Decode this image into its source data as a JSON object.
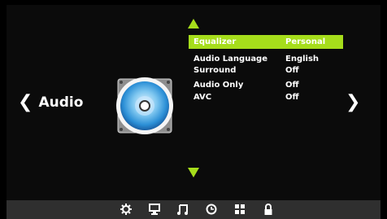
{
  "section": {
    "title": "Audio",
    "prev_icon": "chevron-left-icon",
    "next_icon": "chevron-right-icon"
  },
  "menu": {
    "items": [
      {
        "label": "Equalizer",
        "value": "Personal",
        "selected": true
      },
      {
        "label": "Audio Language",
        "value": "English",
        "selected": false
      },
      {
        "label": "Surround",
        "value": "Off",
        "selected": false
      },
      {
        "label": "Audio Only",
        "value": "Off",
        "selected": false
      },
      {
        "label": "AVC",
        "value": "Off",
        "selected": false
      }
    ]
  },
  "bottom_bar": {
    "icons": [
      "settings-gear-icon",
      "monitor-icon",
      "music-note-icon",
      "clock-icon",
      "grid-icon",
      "lock-icon"
    ]
  },
  "colors": {
    "accent": "#a6dd1b",
    "background": "#000000",
    "bar": "#2f2f2f"
  }
}
